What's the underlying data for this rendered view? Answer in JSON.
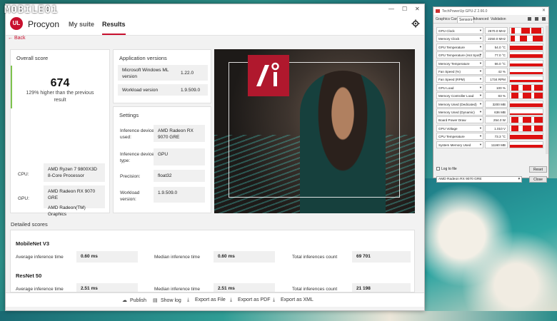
{
  "logo": {
    "text": "MOBILE01"
  },
  "app": {
    "name": "Procyon",
    "nav": [
      "My suite",
      "Results"
    ],
    "back_label": "Back",
    "overall": {
      "title": "Overall score",
      "score": "674",
      "comparison": "129% higher than the previous result",
      "cpu_label": "CPU:",
      "cpu_value": "AMD Ryzen 7 9800X3D 8-Core Processor",
      "gpu_label": "GPU:",
      "gpu_value_1": "AMD Radeon RX 9070 GRE",
      "gpu_value_2": "AMD Radeon(TM) Graphics"
    },
    "versions": {
      "title": "Application versions",
      "rows": [
        {
          "label": "Microsoft Windows ML version",
          "value": "1.22.0"
        },
        {
          "label": "Workload version",
          "value": "1.9.509.0"
        }
      ]
    },
    "settings": {
      "title": "Settings",
      "rows": [
        {
          "label": "Inference device used:",
          "value": "AMD Radeon RX 9070 GRE"
        },
        {
          "label": "Inference device type:",
          "value": "GPU"
        },
        {
          "label": "Precision:",
          "value": "float32"
        },
        {
          "label": "Workload version:",
          "value": "1.9.509.0"
        }
      ]
    },
    "detailed": {
      "title": "Detailed scores",
      "col_labels": [
        "Average inference time",
        "Median inference time",
        "Total inferences count"
      ],
      "benchmarks": [
        {
          "name": "MobileNet V3",
          "avg": "0.60 ms",
          "median": "0.60 ms",
          "total": "69 701"
        },
        {
          "name": "ResNet 50",
          "avg": "2.51 ms",
          "median": "2.51 ms",
          "total": "21 198"
        }
      ]
    },
    "footer": [
      "Publish",
      "Show log",
      "Export as File",
      "Export as PDF",
      "Export as XML"
    ]
  },
  "gpuz": {
    "title": "TechPowerUp GPU-Z 2.66.0",
    "tabs": [
      "Graphics Card",
      "Sensors",
      "Advanced",
      "Validation"
    ],
    "sensors": [
      {
        "name": "GPU Clock",
        "value": "2670.0 MHz"
      },
      {
        "name": "Memory Clock",
        "value": "2250.0 MHz"
      },
      {
        "name": "GPU Temperature",
        "value": "54.0 °C"
      },
      {
        "name": "GPU Temperature (Hot Spot)",
        "value": "77.0 °C"
      },
      {
        "name": "Memory Temperature",
        "value": "66.0 °C"
      },
      {
        "name": "Fan Speed (%)",
        "value": "42 %"
      },
      {
        "name": "Fan Speed (RPM)",
        "value": "1734 RPM"
      },
      {
        "name": "GPU Load",
        "value": "100 %"
      },
      {
        "name": "Memory Controller Load",
        "value": "83 %"
      },
      {
        "name": "Memory Used (Dedicated)",
        "value": "3200 MB"
      },
      {
        "name": "Memory Used (Dynamic)",
        "value": "636 MB"
      },
      {
        "name": "Board Power Draw",
        "value": "254.0 W"
      },
      {
        "name": "GPU Voltage",
        "value": "1.010 V"
      },
      {
        "name": "CPU Temperature",
        "value": "73.3 °C"
      },
      {
        "name": "System Memory Used",
        "value": "11160 MB"
      }
    ],
    "log_label": "Log to file",
    "reset_label": "Reset",
    "device": "AMD Radeon RX 9070 GRE",
    "close_label": "Close"
  }
}
